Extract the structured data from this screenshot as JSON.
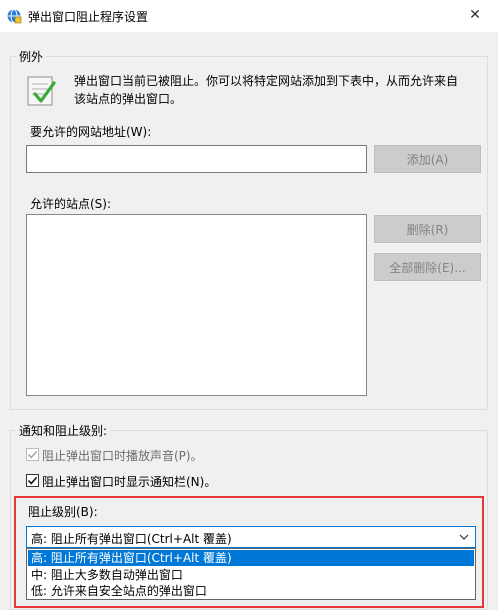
{
  "window": {
    "title": "弹出窗口阻止程序设置"
  },
  "exceptions": {
    "group_title": "例外",
    "description_line1": "弹出窗口当前已被阻止。你可以将特定网站添加到下表中，从而允许来自",
    "description_line2": "该站点的弹出窗口。",
    "address_label": "要允许的网站地址(W):",
    "address_value": "",
    "add_button": "添加(A)",
    "allowed_label": "允许的站点(S):",
    "allowed_sites": [],
    "remove_button": "删除(R)",
    "remove_all_button": "全部删除(E)..."
  },
  "notifications": {
    "group_title": "通知和阻止级别:",
    "play_sound": {
      "label": "阻止弹出窗口时播放声音(P)。",
      "checked": true,
      "enabled": false
    },
    "show_bar": {
      "label": "阻止弹出窗口时显示通知栏(N)。",
      "checked": true,
      "enabled": true
    },
    "level_label": "阻止级别(B):",
    "level_selected": "高: 阻止所有弹出窗口(Ctrl+Alt 覆盖)",
    "level_options": [
      "高: 阻止所有弹出窗口(Ctrl+Alt 覆盖)",
      "中: 阻止大多数自动弹出窗口",
      "低: 允许来自安全站点的弹出窗口"
    ]
  },
  "colors": {
    "highlight": "#0078d7",
    "annotation": "#e53935"
  }
}
